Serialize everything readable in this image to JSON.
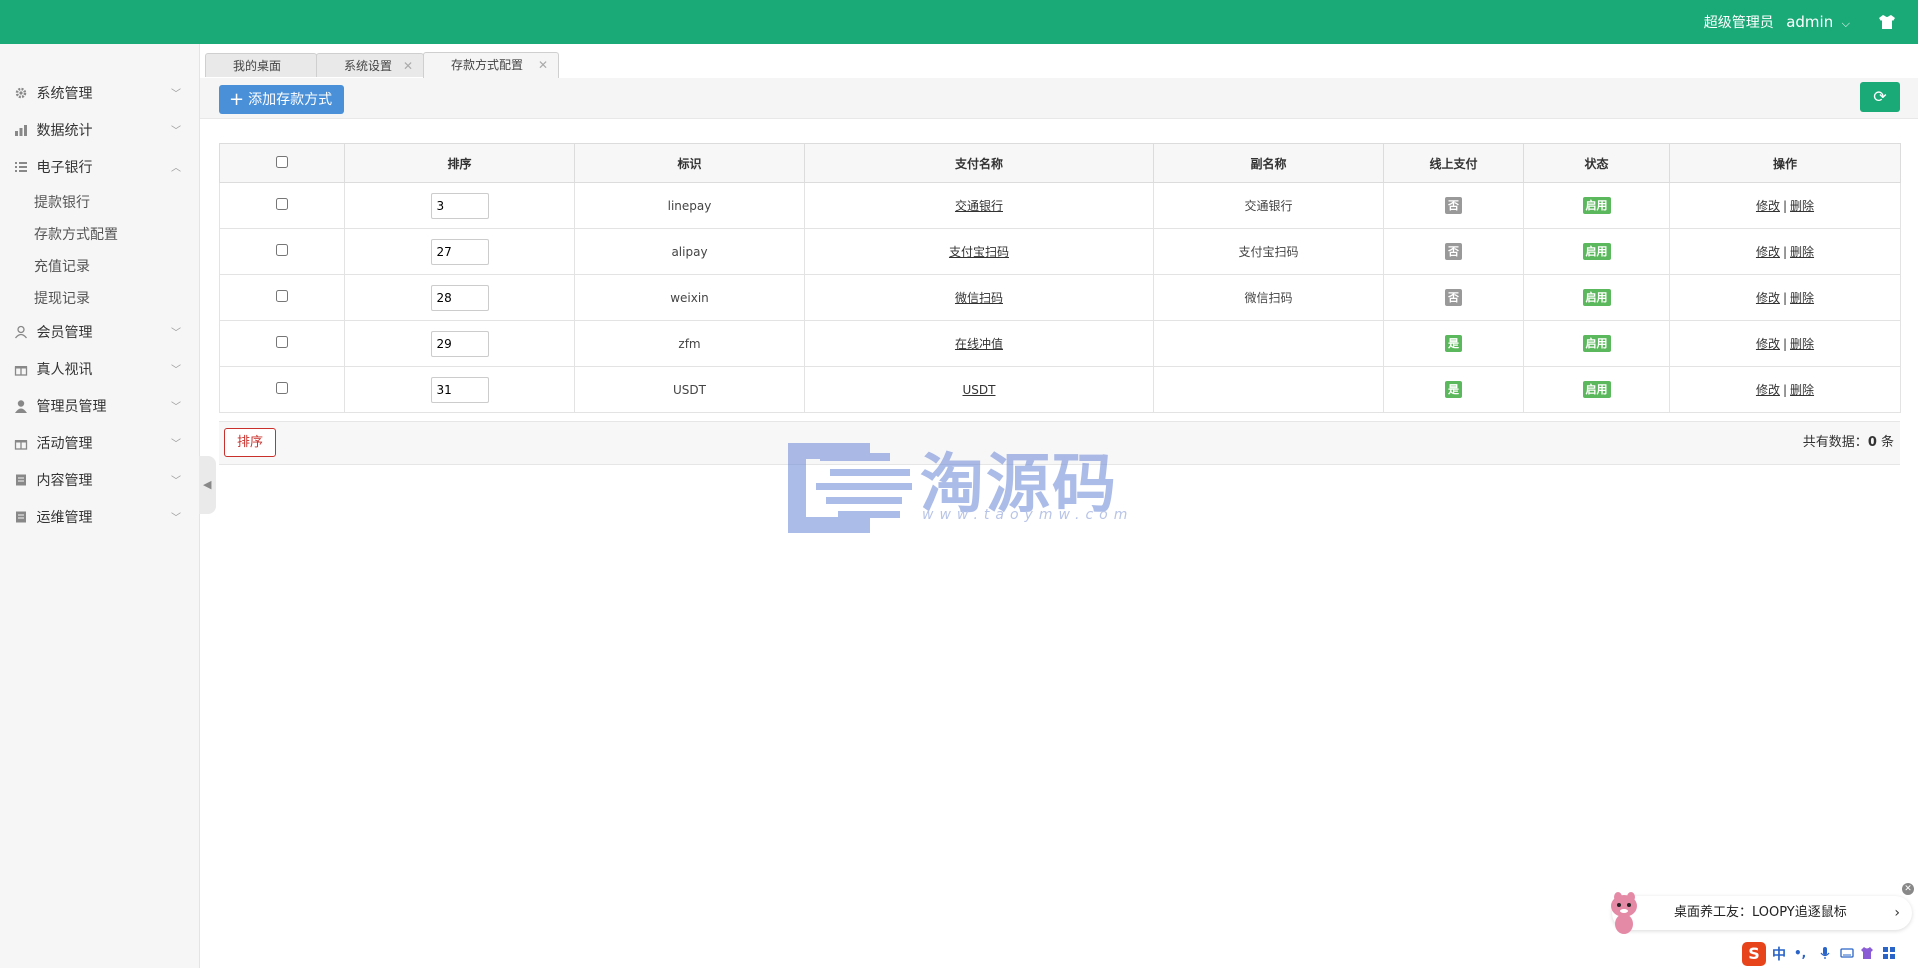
{
  "header": {
    "role": "超级管理员",
    "username": "admin"
  },
  "sidebar": {
    "items": [
      {
        "label": "系统管理",
        "expanded": false
      },
      {
        "label": "数据统计",
        "expanded": false
      },
      {
        "label": "电子银行",
        "expanded": true,
        "children": [
          "提款银行",
          "存款方式配置",
          "充值记录",
          "提现记录"
        ]
      },
      {
        "label": "会员管理",
        "expanded": false
      },
      {
        "label": "真人视讯",
        "expanded": false
      },
      {
        "label": "管理员管理",
        "expanded": false
      },
      {
        "label": "活动管理",
        "expanded": false
      },
      {
        "label": "内容管理",
        "expanded": false
      },
      {
        "label": "运维管理",
        "expanded": false
      }
    ]
  },
  "tabs": [
    {
      "label": "我的桌面"
    },
    {
      "label": "系统设置"
    },
    {
      "label": "存款方式配置",
      "active": true
    }
  ],
  "toolbar": {
    "add_label": "添加存款方式"
  },
  "table": {
    "columns": [
      "排序",
      "标识",
      "支付名称",
      "副名称",
      "线上支付",
      "状态",
      "操作"
    ],
    "rows": [
      {
        "sort": "3",
        "code": "linepay",
        "name": "交通银行",
        "alias": "交通银行",
        "online": "否",
        "status": "启用"
      },
      {
        "sort": "27",
        "code": "alipay",
        "name": "支付宝扫码",
        "alias": "支付宝扫码",
        "online": "否",
        "status": "启用"
      },
      {
        "sort": "28",
        "code": "weixin",
        "name": "微信扫码",
        "alias": "微信扫码",
        "online": "否",
        "status": "启用"
      },
      {
        "sort": "29",
        "code": "zfm",
        "name": "在线冲值",
        "alias": "",
        "online": "是",
        "status": "启用"
      },
      {
        "sort": "31",
        "code": "USDT",
        "name": "USDT",
        "alias": "",
        "online": "是",
        "status": "启用"
      }
    ],
    "ops": {
      "edit": "修改",
      "sep": "|",
      "delete": "删除"
    }
  },
  "footer": {
    "sort_button": "排序",
    "total_prefix": "共有数据：",
    "total_count": "0",
    "total_suffix": " 条"
  },
  "watermark": {
    "title": "淘源码",
    "url": "www.taoymw.com"
  },
  "notice": {
    "text": "桌面养工友：LOOPY追逐鼠标",
    "arrow": "›"
  },
  "ime": {
    "lang": "中",
    "punct": "•,"
  },
  "colors": {
    "brand_green": "#1aaa78",
    "primary_blue": "#4a90d9",
    "badge_grey": "#999999",
    "badge_green": "#5cb85c",
    "danger_red": "#c9302c"
  }
}
